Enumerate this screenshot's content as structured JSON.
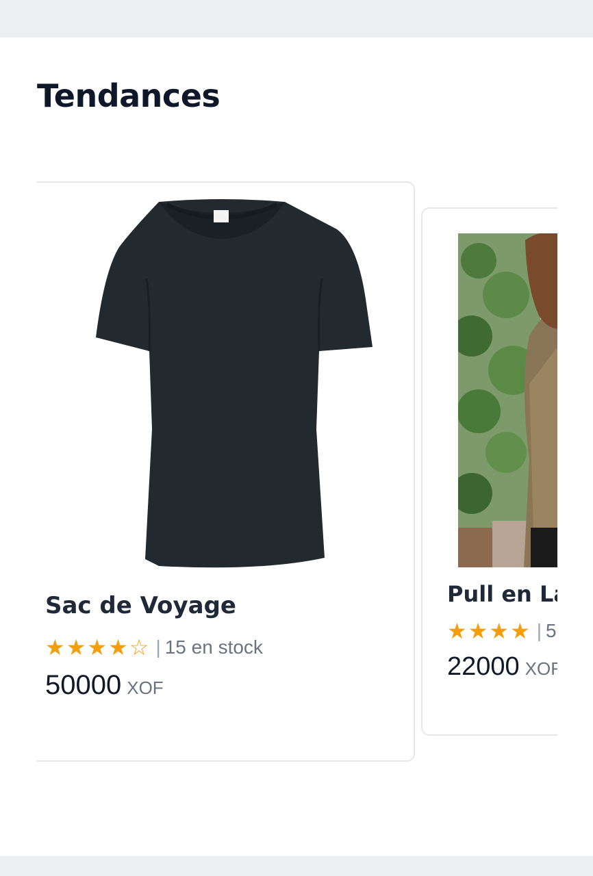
{
  "section": {
    "title": "Tendances"
  },
  "products": [
    {
      "name": "Sac de Voyage",
      "rating_stars": "★★★★☆",
      "rating_value": 4,
      "separator": "|",
      "stock_text": "15 en stock",
      "price": "50000",
      "currency": "XOF"
    },
    {
      "name": "Pull en Lai",
      "rating_stars": "★★★★",
      "separator": "|",
      "stock_text": "5",
      "price": "22000",
      "currency": "XOF"
    }
  ],
  "colors": {
    "star": "#f59e0b",
    "title": "#0f172a",
    "tshirt": "#22292f"
  }
}
